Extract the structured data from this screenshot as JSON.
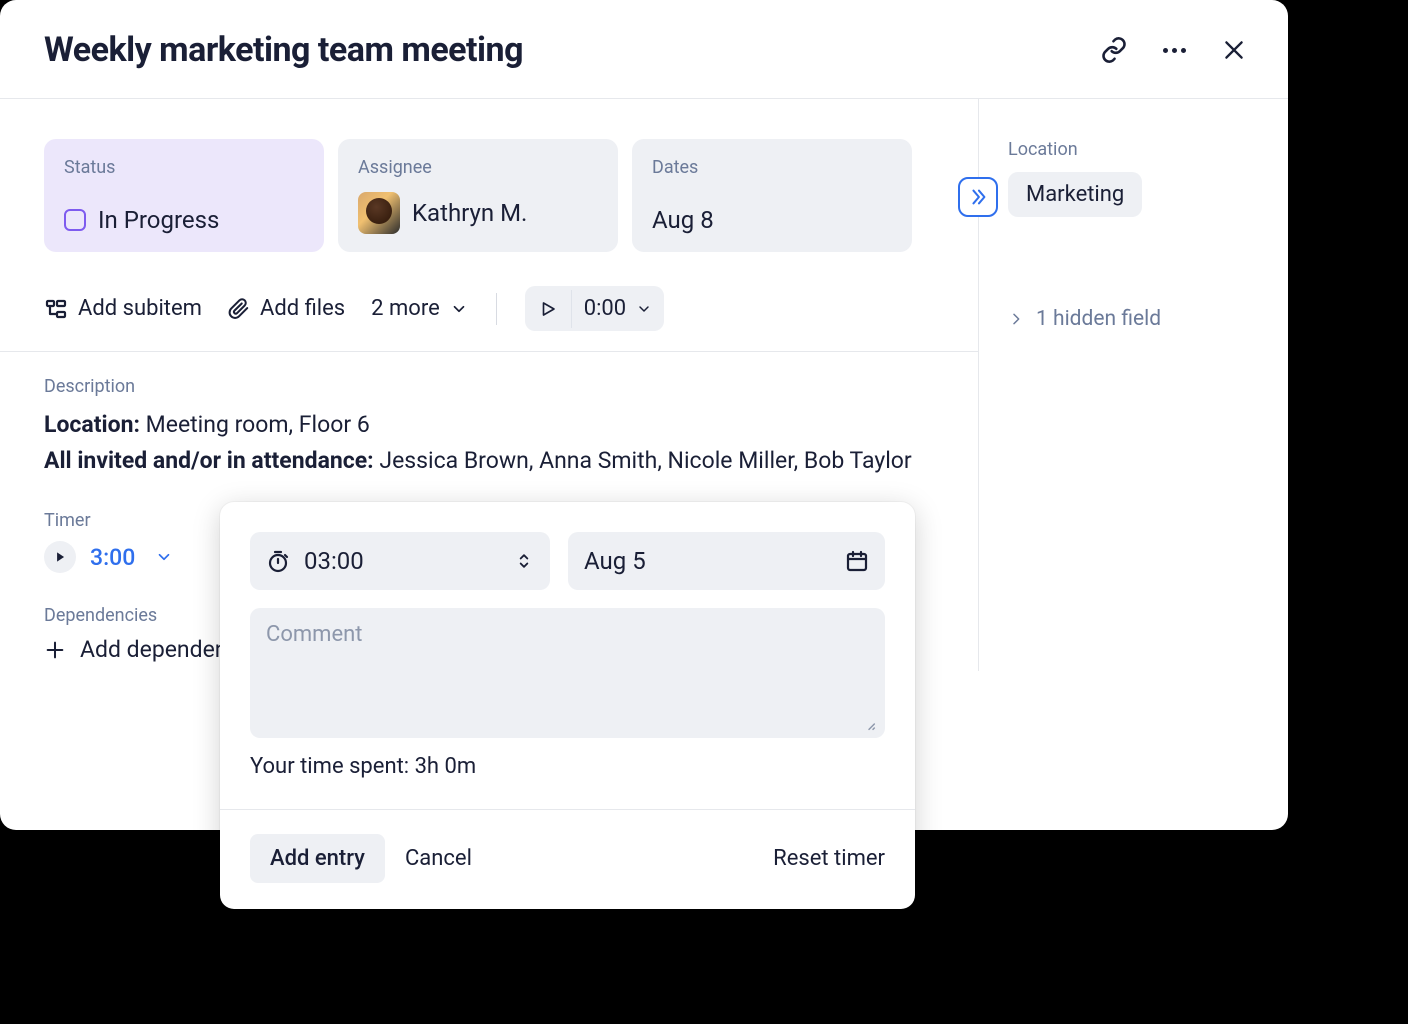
{
  "header": {
    "title": "Weekly marketing team meeting"
  },
  "cards": {
    "status": {
      "label": "Status",
      "value": "In Progress"
    },
    "assignee": {
      "label": "Assignee",
      "value": "Kathryn M."
    },
    "dates": {
      "label": "Dates",
      "value": "Aug 8"
    }
  },
  "actions": {
    "add_subitem": "Add subitem",
    "add_files": "Add files",
    "more": "2 more",
    "timer_value": "0:00"
  },
  "description": {
    "label": "Description",
    "location_label": "Location:",
    "location_value": "Meeting room, Floor 6",
    "attendance_label": "All invited and/or in attendance:",
    "attendance_value": "Jessica Brown, Anna Smith, Nicole Miller, Bob Taylor"
  },
  "timer_section": {
    "label": "Timer",
    "value": "3:00"
  },
  "dependencies": {
    "label": "Dependencies",
    "add": "Add dependency"
  },
  "right": {
    "location_label": "Location",
    "location_value": "Marketing",
    "hidden_field": "1 hidden field"
  },
  "popover": {
    "time": "03:00",
    "date": "Aug 5",
    "comment_placeholder": "Comment",
    "spent": "Your time spent: 3h 0m",
    "add_entry": "Add entry",
    "cancel": "Cancel",
    "reset": "Reset timer"
  }
}
